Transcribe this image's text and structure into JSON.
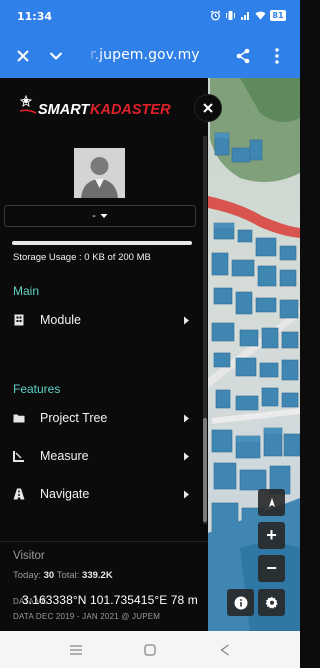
{
  "status_bar": {
    "time": "11:34",
    "battery": "81",
    "icons": [
      "alarm-icon",
      "vibrate-icon",
      "signal-icon",
      "wifi-icon",
      "battery-icon"
    ]
  },
  "browser": {
    "url": "r.jupem.gov.my",
    "icons": [
      "close-icon",
      "chevron-down-icon",
      "share-icon",
      "more-vertical-icon"
    ]
  },
  "drawer": {
    "logo_text_white": "SMART",
    "logo_text_red": "KADASTER",
    "user_select_value": "-",
    "storage_usage": "Storage Usage : 0 KB of 200 MB",
    "sections": [
      {
        "title": "Main",
        "items": [
          {
            "label": "Module",
            "icon": "module-icon"
          }
        ]
      },
      {
        "title": "Features",
        "items": [
          {
            "label": "Project Tree",
            "icon": "folder-icon"
          },
          {
            "label": "Measure",
            "icon": "measure-icon"
          },
          {
            "label": "Navigate",
            "icon": "navigate-icon"
          }
        ]
      }
    ],
    "visitor": {
      "title": "Visitor",
      "today_label": "Today:",
      "today_value": "30",
      "total_label": "Total:",
      "total_value": "339.2K"
    },
    "data_lines": [
      "DATA VE",
      "DATA DEC 2019 - JAN 2021 @ JUPEM"
    ]
  },
  "map": {
    "coordinates": "3.163338°N 101.735415°E 78 m",
    "controls": [
      "compass-icon",
      "zoom-in-button",
      "zoom-out-button",
      "info-icon",
      "settings-icon"
    ],
    "zoom_in_label": "+",
    "zoom_out_label": "−"
  },
  "colors": {
    "browser_bar": "#2f80e8",
    "drawer_bg": "#0b0b0b",
    "section_title": "#5fd3c8",
    "logo_red": "#e0202a"
  }
}
